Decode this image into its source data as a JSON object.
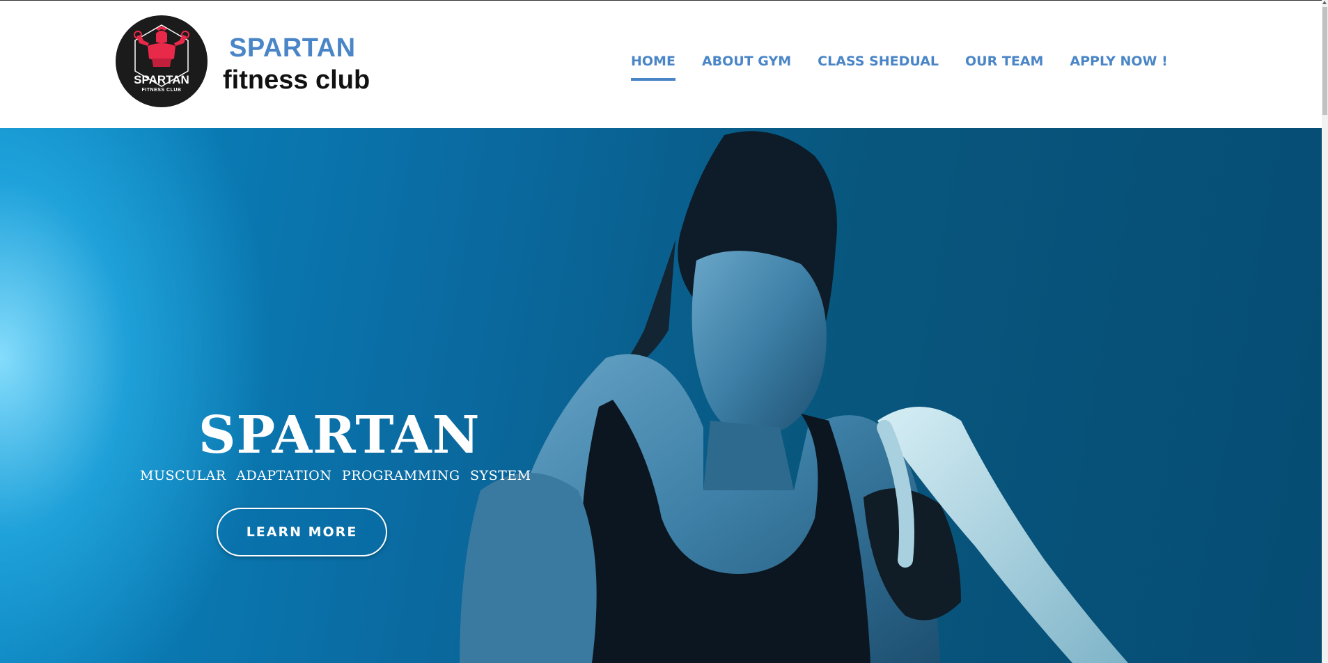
{
  "header": {
    "brand_title": "SPARTAN",
    "brand_subtitle": "fitness club",
    "logo": {
      "icon": "spartan-warrior-icon",
      "text_main": "SPARTAN",
      "text_sub": "FITNESS CLUB",
      "accent_color": "#e8294a"
    }
  },
  "nav": {
    "items": [
      {
        "label": "HOME",
        "active": true
      },
      {
        "label": "ABOUT GYM",
        "active": false
      },
      {
        "label": "CLASS SHEDUAL",
        "active": false
      },
      {
        "label": "OUR TEAM",
        "active": false
      },
      {
        "label": "APPLY NOW !",
        "active": false
      }
    ]
  },
  "hero": {
    "title": "SPARTAN",
    "subtitle": "MUSCULAR ADAPTATION PROGRAMMING SYSTEM",
    "cta_label": "LEARN MORE",
    "image": "woman-battle-ropes-photo"
  },
  "colors": {
    "brand_blue": "#4a86c7",
    "hero_blue": "#0a6aa0",
    "white": "#ffffff"
  }
}
